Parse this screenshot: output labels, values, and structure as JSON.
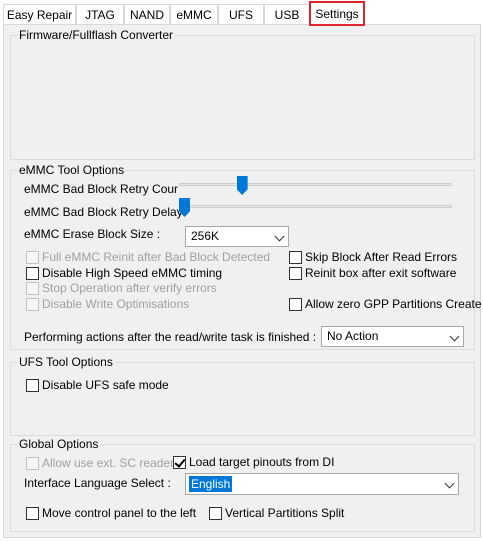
{
  "tabs": [
    {
      "label": "Easy Repair"
    },
    {
      "label": "JTAG"
    },
    {
      "label": "NAND"
    },
    {
      "label": "eMMC"
    },
    {
      "label": "UFS"
    },
    {
      "label": "USB"
    },
    {
      "label": "Settings",
      "active": true
    }
  ],
  "colors": {
    "active_tab_border": "#e0242e",
    "slider_thumb": "#0078d7",
    "selection": "#0078d7",
    "panel_bg": "#f0f0f0"
  },
  "firmware_group": {
    "title": "Firmware/Fullflash Converter"
  },
  "emmc_group": {
    "title": "eMMC Tool Options",
    "retry_count_label": "eMMC Bad Block Retry Cour",
    "retry_count_value": 0.22,
    "retry_delay_label": "eMMC Bad Block Retry Delay",
    "retry_delay_value": 0.0,
    "erase_block_label": "eMMC Erase Block Size :",
    "erase_block_value": "256K",
    "full_reinit": {
      "label": "Full eMMC Reinit after Bad Block Detected",
      "checked": false,
      "enabled": false
    },
    "disable_high_speed": {
      "label": "Disable High Speed eMMC timing",
      "checked": false,
      "enabled": true
    },
    "stop_after_verify": {
      "label": "Stop Operation after verify errors",
      "checked": false,
      "enabled": false
    },
    "disable_write_opt": {
      "label": "Disable Write Optimisations",
      "checked": false,
      "enabled": false
    },
    "skip_block": {
      "label": "Skip Block After Read Errors",
      "checked": false,
      "enabled": true
    },
    "reinit_box": {
      "label": "Reinit box after exit software",
      "checked": false,
      "enabled": true
    },
    "allow_zero_gpp": {
      "label": "Allow zero GPP Partitions Create",
      "checked": false,
      "enabled": true
    },
    "after_task_label": "Performing actions after the read/write task is finished :",
    "after_task_value": "No Action"
  },
  "ufs_group": {
    "title": "UFS Tool Options",
    "disable_safe_mode": {
      "label": "Disable UFS safe mode",
      "checked": false
    }
  },
  "global_group": {
    "title": "Global Options",
    "allow_sc_readers": {
      "label": "Allow use ext. SC readers",
      "checked": false,
      "enabled": false
    },
    "load_pinouts": {
      "label": "Load target pinouts from DI",
      "checked": true
    },
    "language_label": "Interface Language Select :",
    "language_value": "English",
    "move_panel": {
      "label": "Move control panel to the left",
      "checked": false
    },
    "vertical_split": {
      "label": "Vertical Partitions Split",
      "checked": false
    }
  }
}
